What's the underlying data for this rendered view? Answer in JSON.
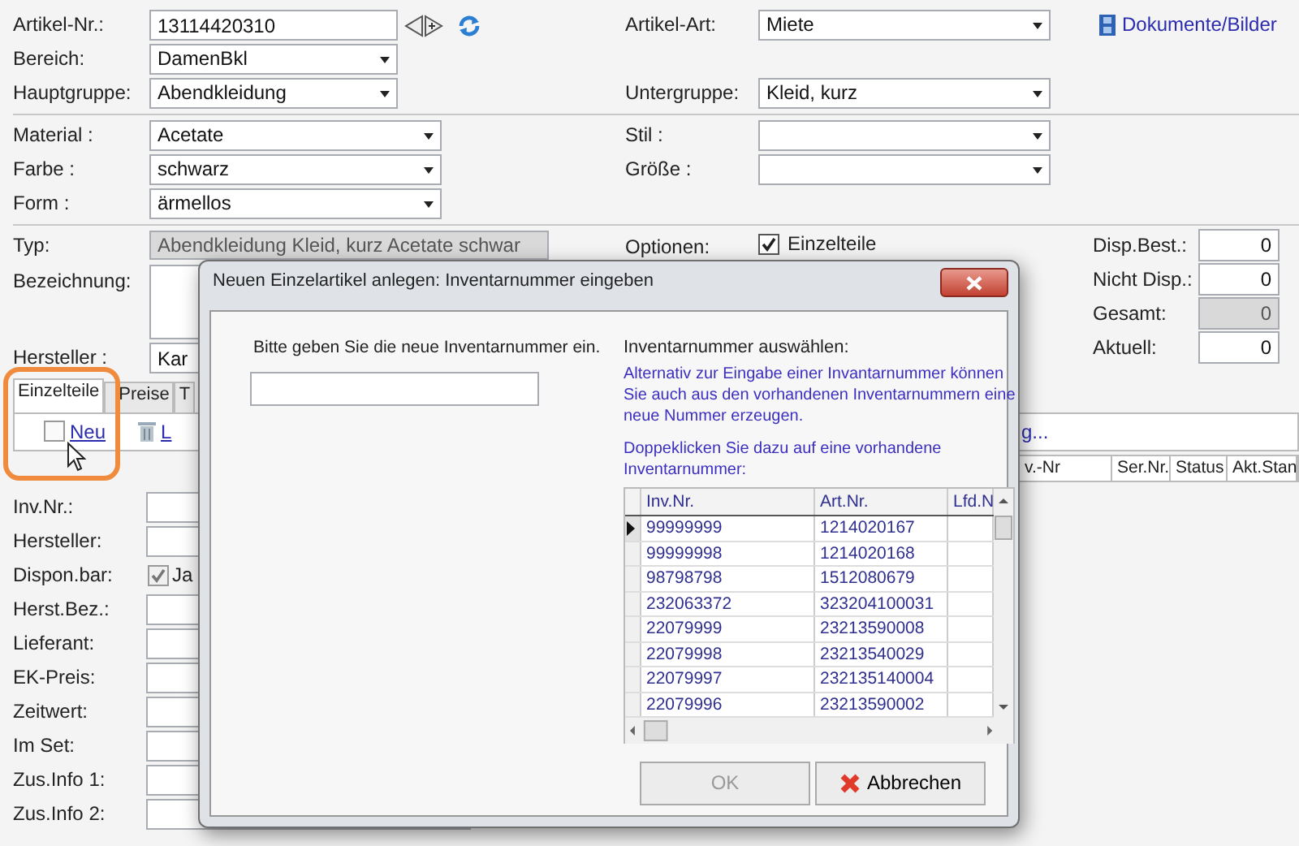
{
  "top_rows": [
    {
      "left": {
        "label": "Artikel-Nr.:",
        "kind": "text",
        "value": "13114420310",
        "nav": true
      },
      "right": {
        "label": "Artikel-Art:",
        "kind": "select",
        "value": "Miete"
      }
    },
    {
      "left": {
        "label": "Bereich:",
        "kind": "select",
        "value": "DamenBkl"
      }
    },
    {
      "left": {
        "label": "Hauptgruppe:",
        "kind": "select",
        "value": "Abendkleidung"
      },
      "right": {
        "label": "Untergruppe:",
        "kind": "select",
        "value": "Kleid, kurz"
      }
    }
  ],
  "documents_link": "Dokumente/Bilder",
  "attribute_rows": [
    {
      "left": {
        "label": "Material :",
        "kind": "select",
        "value": "Acetate"
      },
      "right": {
        "label": "Stil :",
        "kind": "select"
      }
    },
    {
      "left": {
        "label": "Farbe :",
        "kind": "select",
        "value": "schwarz"
      },
      "right": {
        "label": "Größe :",
        "kind": "select"
      }
    },
    {
      "left": {
        "label": "Form :",
        "kind": "select",
        "value": "ärmellos"
      }
    }
  ],
  "typ": {
    "label": "Typ:",
    "value": "Abendkleidung Kleid, kurz Acetate schwar"
  },
  "bezeichnung": {
    "label": "Bezeichnung:"
  },
  "hersteller": {
    "label": "Hersteller :",
    "value": "Kar"
  },
  "options": {
    "label": "Optionen:",
    "items": [
      {
        "label": "Einzelteile",
        "checked": true
      }
    ]
  },
  "stock": [
    {
      "label": "Disp.Best.:",
      "value": "0",
      "readonly": false
    },
    {
      "label": "Nicht Disp.:",
      "value": "0",
      "readonly": false
    },
    {
      "label": "Gesamt:",
      "value": "0",
      "readonly": true
    },
    {
      "label": "Aktuell:",
      "value": "0",
      "readonly": false
    }
  ],
  "tabs": [
    {
      "label": "Einzelteile",
      "selected": true
    },
    {
      "label": "Preise",
      "selected": false
    },
    {
      "label": "T",
      "selected": false
    }
  ],
  "toolbar": [
    {
      "label": "Neu",
      "kind": "new"
    },
    {
      "label": "L",
      "kind": "delete"
    }
  ],
  "toolbar_right_text": "g...",
  "items_table": {
    "columns": [
      "v.-Nr",
      "Ser.Nr.",
      "Status",
      "Akt.Stan"
    ]
  },
  "detail_fields": [
    {
      "label": "Inv.Nr.:",
      "kind": "text"
    },
    {
      "label": "Hersteller:",
      "kind": "text"
    },
    {
      "label": "Dispon.bar:",
      "kind": "checkbox",
      "checked": true,
      "value": "Ja"
    },
    {
      "label": "Herst.Bez.:",
      "kind": "text"
    },
    {
      "label": "Lieferant:",
      "kind": "text"
    },
    {
      "label": "EK-Preis:",
      "kind": "text"
    },
    {
      "label": "Zeitwert:",
      "kind": "text"
    },
    {
      "label": "Im Set:",
      "kind": "text"
    },
    {
      "label": "Zus.Info 1:",
      "kind": "text"
    },
    {
      "label": "Zus.Info 2:",
      "kind": "text"
    }
  ],
  "dialog": {
    "title": "Neuen Einzelartikel anlegen: Inventarnummer eingeben",
    "prompt": "Bitte geben Sie die neue Inventarnummer ein.",
    "heading": "Inventarnummer auswählen:",
    "info": [
      "Alternativ zur Eingabe einer Invantarnummer können Sie auch aus den vorhandenen Inventarnummern eine neue Nummer erzeugen.",
      "Doppeklicken Sie dazu auf eine vorhandene Inventarnummer:"
    ],
    "grid": {
      "columns": [
        "Inv.Nr.",
        "Art.Nr.",
        "Lfd.N"
      ],
      "rows": [
        {
          "inv": "99999999",
          "art": "1214020167",
          "selected": true
        },
        {
          "inv": "99999998",
          "art": "1214020168",
          "selected": false
        },
        {
          "inv": "98798798",
          "art": "1512080679",
          "selected": false
        },
        {
          "inv": "232063372",
          "art": "323204100031",
          "selected": false
        },
        {
          "inv": "22079999",
          "art": "23213590008",
          "selected": false
        },
        {
          "inv": "22079998",
          "art": "23213540029",
          "selected": false
        },
        {
          "inv": "22079997",
          "art": "232135140004",
          "selected": false
        },
        {
          "inv": "22079996",
          "art": "23213590002",
          "selected": false
        }
      ]
    },
    "buttons": [
      {
        "label": "OK",
        "kind": "ok",
        "disabled": true
      },
      {
        "label": "Abbrechen",
        "kind": "cancel",
        "disabled": false
      }
    ]
  }
}
